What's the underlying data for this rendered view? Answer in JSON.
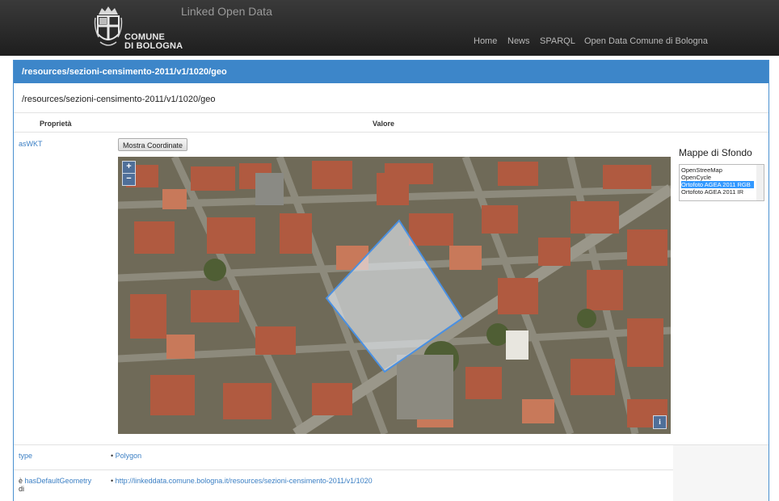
{
  "header": {
    "site_title": "Linked Open Data",
    "logo_line1": "COMUNE",
    "logo_line2": "DI BOLOGNA",
    "nav": [
      "Home",
      "News",
      "SPARQL",
      "Open Data Comune di Bologna"
    ]
  },
  "panel": {
    "heading": "/resources/sezioni-censimento-2011/v1/1020/geo",
    "subtitle": "/resources/sezioni-censimento-2011/v1/1020/geo",
    "col_property": "Proprietà",
    "col_value": "Valore"
  },
  "rows": {
    "aswkt": {
      "property": "asWKT",
      "button": "Mostra Coordinate"
    },
    "type": {
      "property": "type",
      "value": "Polygon"
    },
    "default_geometry": {
      "property_prefix": "è",
      "property_link": "hasDefaultGeometry",
      "property_suffix": "di",
      "value": "http://linkeddata.comune.bologna.it/resources/sezioni-censimento-2011/v1/1020"
    }
  },
  "map": {
    "zoom_in": "+",
    "zoom_out": "−",
    "info": "i",
    "layers_title": "Mappe di Sfondo",
    "layers": [
      "OpenStreeMap",
      "OpenCycle",
      "Ortofoto AGEA 2011 RGB",
      "Ortofoto AGEA 2011 IR"
    ],
    "selected_layer": "Ortofoto AGEA 2011 RGB"
  },
  "colors": {
    "header_bg": "#2b2b2b",
    "panel_heading": "#3d86c9",
    "link": "#3b7fc4",
    "polygon_stroke": "#4a90e2",
    "selected_layer": "#3399ff"
  }
}
